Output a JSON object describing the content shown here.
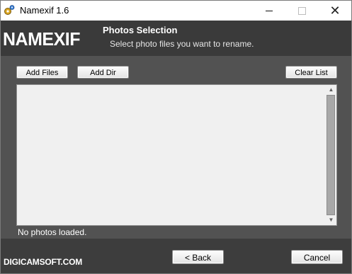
{
  "window": {
    "title": "Namexif 1.6",
    "minimize_glyph": "",
    "close_glyph": "✕"
  },
  "header": {
    "logo": "NAMEXIF",
    "section_title": "Photos Selection",
    "section_subtitle": "Select photo files you want to rename."
  },
  "toolbar": {
    "add_files": "Add Files",
    "add_dir": "Add Dir",
    "clear_list": "Clear List"
  },
  "photo_list": {
    "items": [],
    "scroll_up": "▲",
    "scroll_down": "▼",
    "status": "No photos loaded."
  },
  "footer": {
    "company": "DIGICAMSOFT.COM",
    "back": "< Back",
    "cancel": "Cancel"
  },
  "icons": {
    "app": "gear-sparkle-icon"
  },
  "colors": {
    "header_bg": "#3a3a3a",
    "panel_bg": "#525252",
    "footer_bg": "#3d3d3d"
  }
}
